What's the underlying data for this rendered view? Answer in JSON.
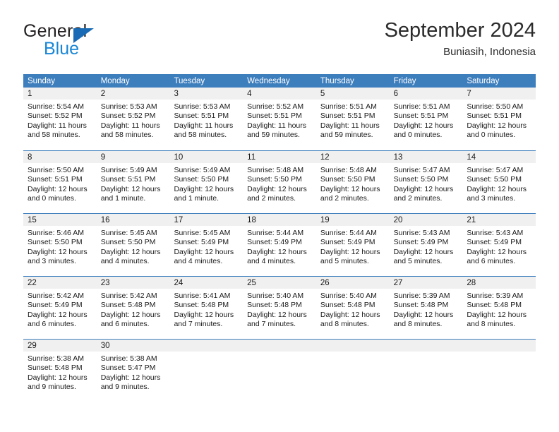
{
  "brand": {
    "name_part1": "General",
    "name_part2": "Blue",
    "icon": "triangle-logo-icon"
  },
  "header": {
    "month_title": "September 2024",
    "location": "Buniasih, Indonesia"
  },
  "colors": {
    "header_blue": "#3d7ebd",
    "day_number_bg": "#f0f0f0",
    "brand_blue": "#1886d6",
    "text": "#1a1a1a"
  },
  "calendar": {
    "weekdays": [
      "Sunday",
      "Monday",
      "Tuesday",
      "Wednesday",
      "Thursday",
      "Friday",
      "Saturday"
    ],
    "weeks": [
      [
        {
          "day": "1",
          "sunrise": "Sunrise: 5:54 AM",
          "sunset": "Sunset: 5:52 PM",
          "daylight": "Daylight: 11 hours and 58 minutes."
        },
        {
          "day": "2",
          "sunrise": "Sunrise: 5:53 AM",
          "sunset": "Sunset: 5:52 PM",
          "daylight": "Daylight: 11 hours and 58 minutes."
        },
        {
          "day": "3",
          "sunrise": "Sunrise: 5:53 AM",
          "sunset": "Sunset: 5:51 PM",
          "daylight": "Daylight: 11 hours and 58 minutes."
        },
        {
          "day": "4",
          "sunrise": "Sunrise: 5:52 AM",
          "sunset": "Sunset: 5:51 PM",
          "daylight": "Daylight: 11 hours and 59 minutes."
        },
        {
          "day": "5",
          "sunrise": "Sunrise: 5:51 AM",
          "sunset": "Sunset: 5:51 PM",
          "daylight": "Daylight: 11 hours and 59 minutes."
        },
        {
          "day": "6",
          "sunrise": "Sunrise: 5:51 AM",
          "sunset": "Sunset: 5:51 PM",
          "daylight": "Daylight: 12 hours and 0 minutes."
        },
        {
          "day": "7",
          "sunrise": "Sunrise: 5:50 AM",
          "sunset": "Sunset: 5:51 PM",
          "daylight": "Daylight: 12 hours and 0 minutes."
        }
      ],
      [
        {
          "day": "8",
          "sunrise": "Sunrise: 5:50 AM",
          "sunset": "Sunset: 5:51 PM",
          "daylight": "Daylight: 12 hours and 0 minutes."
        },
        {
          "day": "9",
          "sunrise": "Sunrise: 5:49 AM",
          "sunset": "Sunset: 5:51 PM",
          "daylight": "Daylight: 12 hours and 1 minute."
        },
        {
          "day": "10",
          "sunrise": "Sunrise: 5:49 AM",
          "sunset": "Sunset: 5:50 PM",
          "daylight": "Daylight: 12 hours and 1 minute."
        },
        {
          "day": "11",
          "sunrise": "Sunrise: 5:48 AM",
          "sunset": "Sunset: 5:50 PM",
          "daylight": "Daylight: 12 hours and 2 minutes."
        },
        {
          "day": "12",
          "sunrise": "Sunrise: 5:48 AM",
          "sunset": "Sunset: 5:50 PM",
          "daylight": "Daylight: 12 hours and 2 minutes."
        },
        {
          "day": "13",
          "sunrise": "Sunrise: 5:47 AM",
          "sunset": "Sunset: 5:50 PM",
          "daylight": "Daylight: 12 hours and 2 minutes."
        },
        {
          "day": "14",
          "sunrise": "Sunrise: 5:47 AM",
          "sunset": "Sunset: 5:50 PM",
          "daylight": "Daylight: 12 hours and 3 minutes."
        }
      ],
      [
        {
          "day": "15",
          "sunrise": "Sunrise: 5:46 AM",
          "sunset": "Sunset: 5:50 PM",
          "daylight": "Daylight: 12 hours and 3 minutes."
        },
        {
          "day": "16",
          "sunrise": "Sunrise: 5:45 AM",
          "sunset": "Sunset: 5:50 PM",
          "daylight": "Daylight: 12 hours and 4 minutes."
        },
        {
          "day": "17",
          "sunrise": "Sunrise: 5:45 AM",
          "sunset": "Sunset: 5:49 PM",
          "daylight": "Daylight: 12 hours and 4 minutes."
        },
        {
          "day": "18",
          "sunrise": "Sunrise: 5:44 AM",
          "sunset": "Sunset: 5:49 PM",
          "daylight": "Daylight: 12 hours and 4 minutes."
        },
        {
          "day": "19",
          "sunrise": "Sunrise: 5:44 AM",
          "sunset": "Sunset: 5:49 PM",
          "daylight": "Daylight: 12 hours and 5 minutes."
        },
        {
          "day": "20",
          "sunrise": "Sunrise: 5:43 AM",
          "sunset": "Sunset: 5:49 PM",
          "daylight": "Daylight: 12 hours and 5 minutes."
        },
        {
          "day": "21",
          "sunrise": "Sunrise: 5:43 AM",
          "sunset": "Sunset: 5:49 PM",
          "daylight": "Daylight: 12 hours and 6 minutes."
        }
      ],
      [
        {
          "day": "22",
          "sunrise": "Sunrise: 5:42 AM",
          "sunset": "Sunset: 5:49 PM",
          "daylight": "Daylight: 12 hours and 6 minutes."
        },
        {
          "day": "23",
          "sunrise": "Sunrise: 5:42 AM",
          "sunset": "Sunset: 5:48 PM",
          "daylight": "Daylight: 12 hours and 6 minutes."
        },
        {
          "day": "24",
          "sunrise": "Sunrise: 5:41 AM",
          "sunset": "Sunset: 5:48 PM",
          "daylight": "Daylight: 12 hours and 7 minutes."
        },
        {
          "day": "25",
          "sunrise": "Sunrise: 5:40 AM",
          "sunset": "Sunset: 5:48 PM",
          "daylight": "Daylight: 12 hours and 7 minutes."
        },
        {
          "day": "26",
          "sunrise": "Sunrise: 5:40 AM",
          "sunset": "Sunset: 5:48 PM",
          "daylight": "Daylight: 12 hours and 8 minutes."
        },
        {
          "day": "27",
          "sunrise": "Sunrise: 5:39 AM",
          "sunset": "Sunset: 5:48 PM",
          "daylight": "Daylight: 12 hours and 8 minutes."
        },
        {
          "day": "28",
          "sunrise": "Sunrise: 5:39 AM",
          "sunset": "Sunset: 5:48 PM",
          "daylight": "Daylight: 12 hours and 8 minutes."
        }
      ],
      [
        {
          "day": "29",
          "sunrise": "Sunrise: 5:38 AM",
          "sunset": "Sunset: 5:48 PM",
          "daylight": "Daylight: 12 hours and 9 minutes."
        },
        {
          "day": "30",
          "sunrise": "Sunrise: 5:38 AM",
          "sunset": "Sunset: 5:47 PM",
          "daylight": "Daylight: 12 hours and 9 minutes."
        },
        {
          "day": "",
          "sunrise": "",
          "sunset": "",
          "daylight": ""
        },
        {
          "day": "",
          "sunrise": "",
          "sunset": "",
          "daylight": ""
        },
        {
          "day": "",
          "sunrise": "",
          "sunset": "",
          "daylight": ""
        },
        {
          "day": "",
          "sunrise": "",
          "sunset": "",
          "daylight": ""
        },
        {
          "day": "",
          "sunrise": "",
          "sunset": "",
          "daylight": ""
        }
      ]
    ]
  }
}
